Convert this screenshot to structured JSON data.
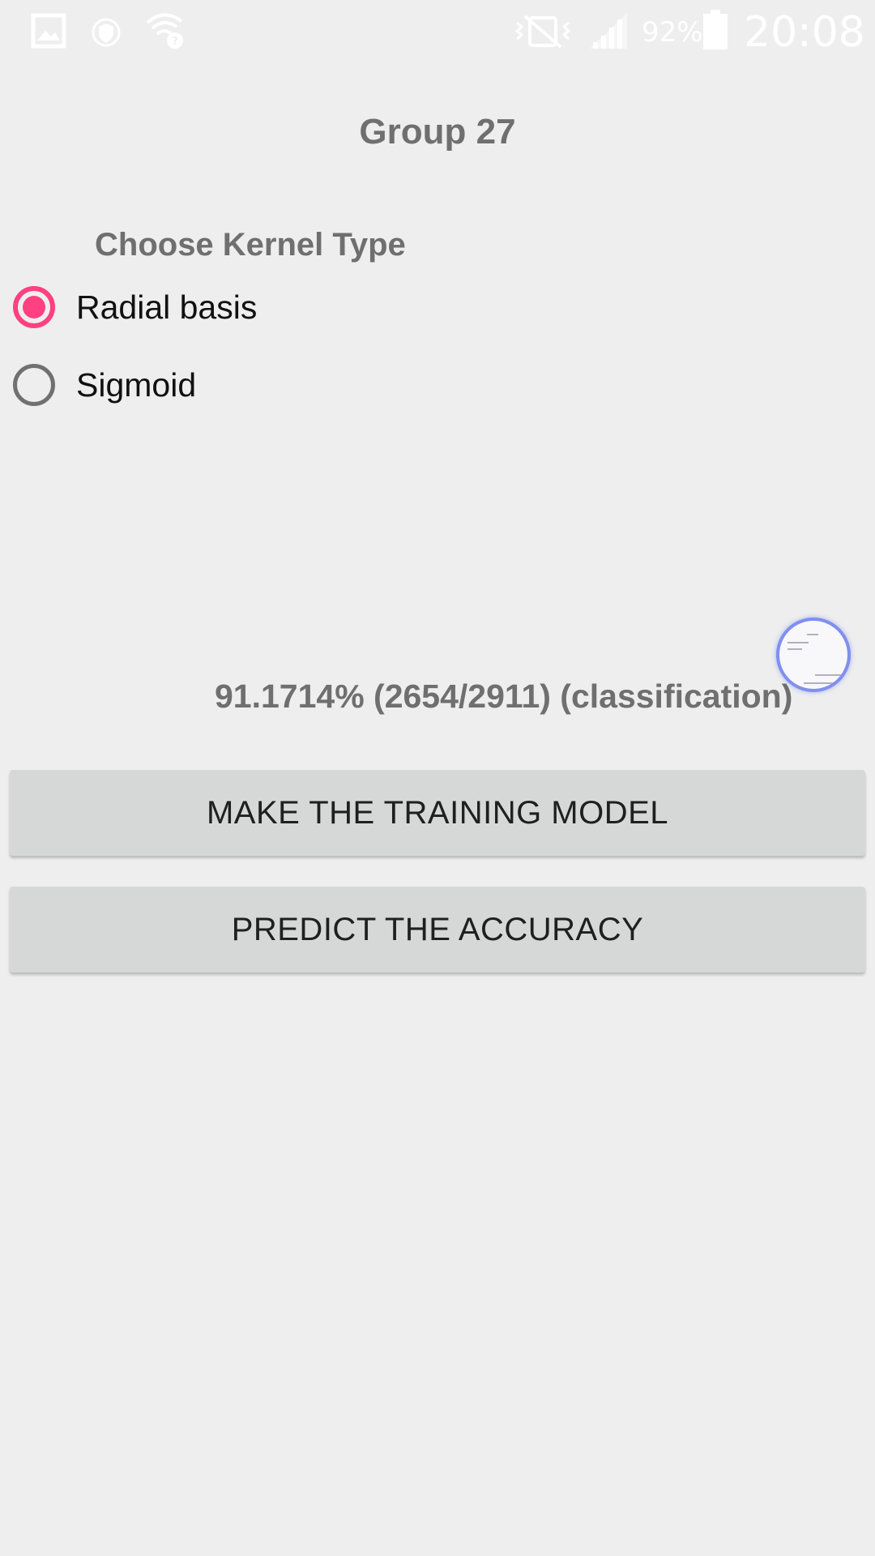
{
  "status_bar": {
    "battery_percent": "92%",
    "time": "20:08",
    "icons": [
      "gallery-icon",
      "shield-icon",
      "wifi-unknown-icon",
      "vibrate-mute-icon",
      "signal-icon",
      "battery-icon"
    ]
  },
  "app": {
    "title": "Group 27"
  },
  "kernel": {
    "label": "Choose Kernel Type",
    "options": [
      {
        "label": "Radial basis",
        "checked": true
      },
      {
        "label": "Sigmoid",
        "checked": false
      }
    ]
  },
  "result": {
    "text": "91.1714% (2654/2911) (classification)"
  },
  "buttons": {
    "train_label": "MAKE THE TRAINING MODEL",
    "predict_label": "PREDICT THE ACCURACY"
  },
  "colors": {
    "accent": "#ff4081",
    "background": "#eeeeef",
    "button": "#d6d7d7",
    "muted_text": "#6f6f6f"
  }
}
